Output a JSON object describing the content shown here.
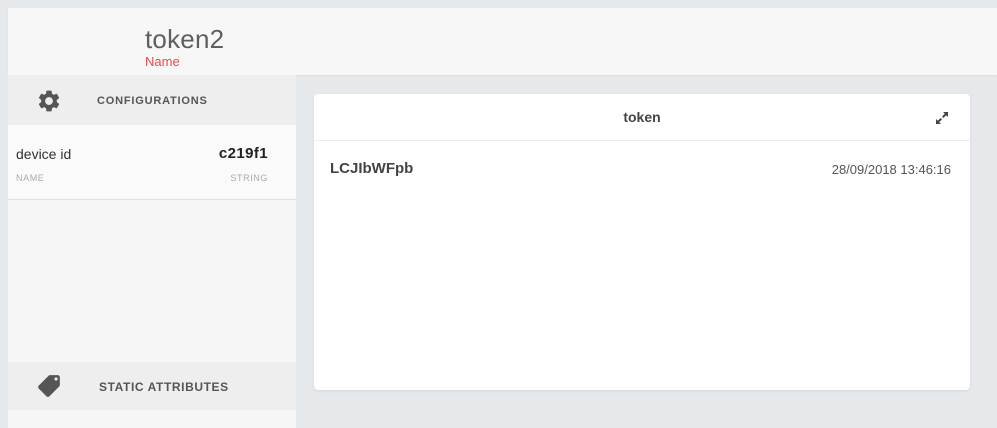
{
  "header": {
    "title": "token2",
    "subtitle": "Name"
  },
  "sidebar": {
    "configurations": {
      "label": "CONFIGURATIONS",
      "icon": "gear-icon",
      "items": [
        {
          "name": "device id",
          "value": "c219f1",
          "name_label": "NAME",
          "type_label": "STRING"
        }
      ]
    },
    "static_attributes": {
      "label": "STATIC ATTRIBUTES",
      "icon": "tag-icon"
    }
  },
  "card": {
    "title": "token",
    "value": "LCJIbWFpb",
    "timestamp": "28/09/2018 13:46:16",
    "expand_icon": "expand-icon"
  },
  "colors": {
    "subtitle": "#e84b4b",
    "background": "#e6e9ec"
  }
}
